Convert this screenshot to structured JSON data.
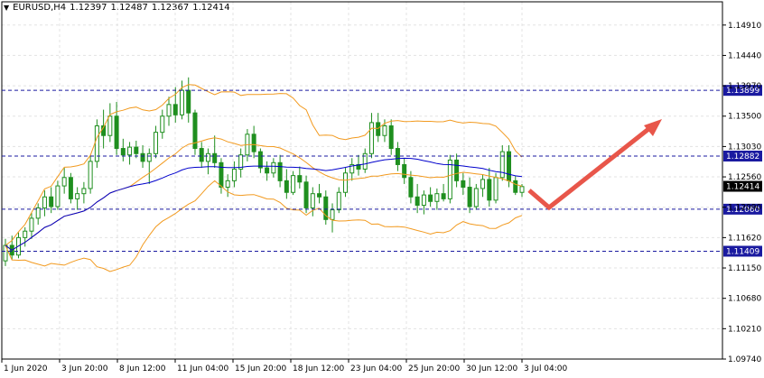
{
  "header": {
    "menu_icon": "triangle-down-icon",
    "symbol": "EURUSD,H4",
    "open": "1.12397",
    "high": "1.12487",
    "low": "1.12367",
    "close": "1.12414"
  },
  "colors": {
    "background": "#ffffff",
    "grid": "#e3e3e3",
    "candle": "#1f8f1f",
    "bands": "#f29a1f",
    "ma": "#0000cc",
    "level_line": "#1a1aa0",
    "level_label_bg": "#1a1aa0",
    "arrow": "#e8564a",
    "price_label_bg": "#000000"
  },
  "y_axis": {
    "ticks": [
      "1.14910",
      "1.14440",
      "1.13970",
      "1.13500",
      "1.13030",
      "1.12560",
      "1.12090",
      "1.11620",
      "1.11150",
      "1.10680",
      "1.10210",
      "1.09740"
    ]
  },
  "x_axis": {
    "ticks": [
      "1 Jun 2020",
      "3 Jun 20:00",
      "8 Jun 12:00",
      "11 Jun 04:00",
      "15 Jun 20:00",
      "18 Jun 12:00",
      "23 Jun 04:00",
      "25 Jun 20:00",
      "30 Jun 12:00",
      "3 Jul 04:00"
    ]
  },
  "levels": [
    "1.13899",
    "1.12882",
    "1.12060",
    "1.11409"
  ],
  "current_price": "1.12414",
  "chart_data": {
    "type": "candlestick",
    "symbol": "EURUSD",
    "timeframe": "H4",
    "ylim": [
      1.0974,
      1.1527
    ],
    "levels": [
      1.13899,
      1.12882,
      1.1206,
      1.11409
    ],
    "ohlc": [
      [
        1.1126,
        1.116,
        1.1118,
        1.115
      ],
      [
        1.115,
        1.1165,
        1.1128,
        1.1135
      ],
      [
        1.1135,
        1.117,
        1.113,
        1.1162
      ],
      [
        1.1162,
        1.1178,
        1.1148,
        1.1172
      ],
      [
        1.1172,
        1.12,
        1.116,
        1.1192
      ],
      [
        1.1192,
        1.1215,
        1.1182,
        1.1208
      ],
      [
        1.1208,
        1.1235,
        1.1195,
        1.1225
      ],
      [
        1.1225,
        1.124,
        1.12,
        1.121
      ],
      [
        1.121,
        1.125,
        1.1205,
        1.1242
      ],
      [
        1.1242,
        1.127,
        1.123,
        1.1255
      ],
      [
        1.1255,
        1.1262,
        1.1215,
        1.1222
      ],
      [
        1.1222,
        1.124,
        1.1205,
        1.123
      ],
      [
        1.123,
        1.1248,
        1.1215,
        1.1238
      ],
      [
        1.1238,
        1.129,
        1.123,
        1.128
      ],
      [
        1.128,
        1.1345,
        1.127,
        1.1335
      ],
      [
        1.1335,
        1.136,
        1.13,
        1.132
      ],
      [
        1.132,
        1.137,
        1.131,
        1.135
      ],
      [
        1.135,
        1.1372,
        1.129,
        1.13
      ],
      [
        1.13,
        1.1315,
        1.128,
        1.129
      ],
      [
        1.129,
        1.131,
        1.1275,
        1.1302
      ],
      [
        1.1302,
        1.1312,
        1.1285,
        1.1292
      ],
      [
        1.1292,
        1.1305,
        1.127,
        1.128
      ],
      [
        1.128,
        1.13,
        1.1245,
        1.1292
      ],
      [
        1.1292,
        1.1335,
        1.1285,
        1.1325
      ],
      [
        1.1325,
        1.136,
        1.1315,
        1.135
      ],
      [
        1.135,
        1.138,
        1.1335,
        1.1368
      ],
      [
        1.1368,
        1.1395,
        1.134,
        1.1352
      ],
      [
        1.1352,
        1.1405,
        1.1345,
        1.139
      ],
      [
        1.139,
        1.141,
        1.134,
        1.1355
      ],
      [
        1.1355,
        1.136,
        1.129,
        1.13
      ],
      [
        1.13,
        1.131,
        1.127,
        1.128
      ],
      [
        1.128,
        1.13,
        1.126,
        1.1292
      ],
      [
        1.1292,
        1.132,
        1.127,
        1.1278
      ],
      [
        1.1278,
        1.1285,
        1.123,
        1.124
      ],
      [
        1.124,
        1.126,
        1.1225,
        1.125
      ],
      [
        1.125,
        1.128,
        1.124,
        1.1268
      ],
      [
        1.1268,
        1.13,
        1.1255,
        1.129
      ],
      [
        1.129,
        1.133,
        1.128,
        1.1322
      ],
      [
        1.1322,
        1.1335,
        1.1285,
        1.1295
      ],
      [
        1.1295,
        1.13,
        1.1262,
        1.127
      ],
      [
        1.127,
        1.128,
        1.125,
        1.1262
      ],
      [
        1.1262,
        1.1285,
        1.1255,
        1.1278
      ],
      [
        1.1278,
        1.129,
        1.124,
        1.125
      ],
      [
        1.125,
        1.1268,
        1.1222,
        1.1232
      ],
      [
        1.1232,
        1.1265,
        1.1228,
        1.1258
      ],
      [
        1.1258,
        1.1272,
        1.1238,
        1.1248
      ],
      [
        1.1248,
        1.1258,
        1.12,
        1.1208
      ],
      [
        1.1208,
        1.124,
        1.1195,
        1.123
      ],
      [
        1.123,
        1.1245,
        1.1215,
        1.1225
      ],
      [
        1.1225,
        1.1235,
        1.1182,
        1.119
      ],
      [
        1.119,
        1.1215,
        1.117,
        1.1205
      ],
      [
        1.1205,
        1.124,
        1.12,
        1.1232
      ],
      [
        1.1232,
        1.127,
        1.1225,
        1.1262
      ],
      [
        1.1262,
        1.1285,
        1.125,
        1.1275
      ],
      [
        1.1275,
        1.129,
        1.1258,
        1.1268
      ],
      [
        1.1268,
        1.13,
        1.1262,
        1.1292
      ],
      [
        1.1292,
        1.1355,
        1.1285,
        1.134
      ],
      [
        1.134,
        1.1355,
        1.131,
        1.132
      ],
      [
        1.132,
        1.1345,
        1.131,
        1.1335
      ],
      [
        1.1335,
        1.1345,
        1.129,
        1.13
      ],
      [
        1.13,
        1.131,
        1.1265,
        1.1275
      ],
      [
        1.1275,
        1.1285,
        1.1245,
        1.1255
      ],
      [
        1.1255,
        1.1265,
        1.1215,
        1.1225
      ],
      [
        1.1225,
        1.1245,
        1.12,
        1.1212
      ],
      [
        1.1212,
        1.1235,
        1.1198,
        1.1228
      ],
      [
        1.1228,
        1.124,
        1.121,
        1.1218
      ],
      [
        1.1218,
        1.1238,
        1.1205,
        1.123
      ],
      [
        1.123,
        1.1245,
        1.1218,
        1.1222
      ],
      [
        1.1222,
        1.129,
        1.1215,
        1.1282
      ],
      [
        1.1282,
        1.1292,
        1.124,
        1.125
      ],
      [
        1.125,
        1.1262,
        1.1228,
        1.124
      ],
      [
        1.124,
        1.1255,
        1.12,
        1.121
      ],
      [
        1.121,
        1.1245,
        1.1205,
        1.1238
      ],
      [
        1.1238,
        1.126,
        1.1225,
        1.1252
      ],
      [
        1.1252,
        1.127,
        1.121,
        1.122
      ],
      [
        1.122,
        1.1262,
        1.1215,
        1.1255
      ],
      [
        1.1255,
        1.1305,
        1.125,
        1.1295
      ],
      [
        1.1295,
        1.1305,
        1.124,
        1.125
      ],
      [
        1.125,
        1.1258,
        1.1228,
        1.1232
      ],
      [
        1.1232,
        1.1245,
        1.1225,
        1.1241
      ]
    ]
  }
}
